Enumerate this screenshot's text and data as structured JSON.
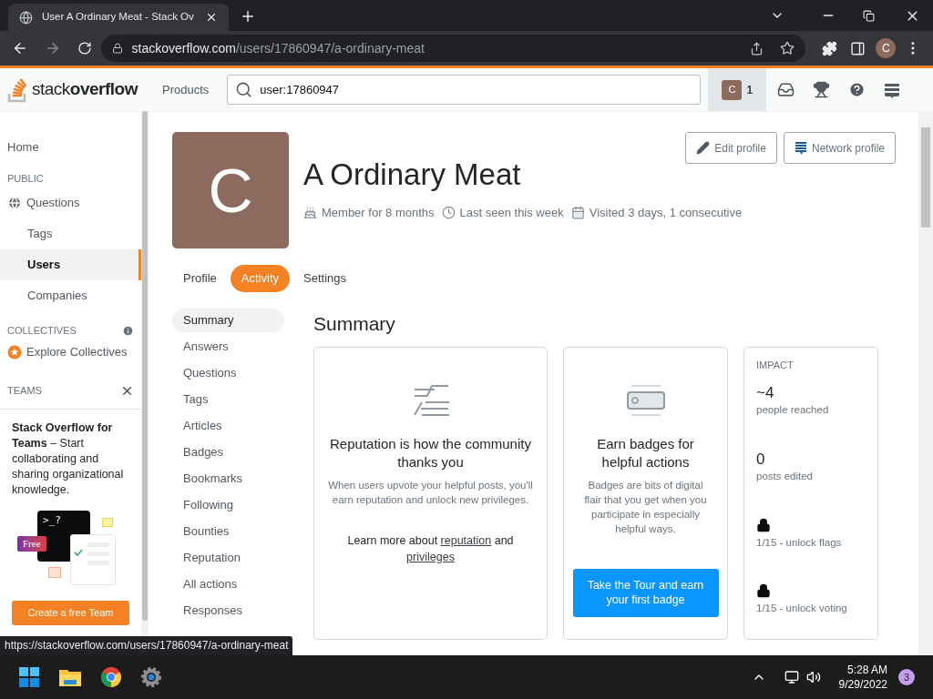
{
  "browser": {
    "tab_title": "User A Ordinary Meat - Stack Ov",
    "url_host": "stackoverflow.com",
    "url_path": "/users/17860947/a-ordinary-meat",
    "profile_letter": "C"
  },
  "header": {
    "logo": "stack**overflow**",
    "products": "Products",
    "search": "user:17860947",
    "avatar_letter": "C",
    "reputation": "1"
  },
  "sidebar": {
    "items": [
      {
        "kind": "link",
        "label": "Home",
        "selected": false
      },
      {
        "kind": "heading",
        "label": "PUBLIC"
      },
      {
        "kind": "globe",
        "label": "Questions",
        "selected": false
      },
      {
        "kind": "sub",
        "label": "Tags",
        "selected": false
      },
      {
        "kind": "sub",
        "label": "Users",
        "selected": true
      },
      {
        "kind": "sub",
        "label": "Companies",
        "selected": false
      },
      {
        "kind": "info-heading",
        "label": "COLLECTIVES"
      },
      {
        "kind": "collective",
        "label": "Explore Collectives",
        "selected": false
      },
      {
        "kind": "close-heading",
        "label": "TEAMS"
      }
    ],
    "teams": {
      "text": "**Stack Overflow for Teams** – Start collaborating and sharing organizational knowledge.",
      "prompt": ">_?",
      "free": "Free",
      "button": "Create a free Team"
    }
  },
  "profile": {
    "avatar_letter": "C",
    "name": "A Ordinary Meat",
    "meta": [
      {
        "kind": "cake",
        "text": "Member for 8 months"
      },
      {
        "kind": "clock",
        "text": "Last seen this week"
      },
      {
        "kind": "calendar",
        "text": "Visited 3 days, 1 consecutive"
      }
    ],
    "buttons": [
      {
        "kind": "edit",
        "label": "Edit profile"
      },
      {
        "kind": "network",
        "label": "Network profile"
      }
    ],
    "tabs": [
      {
        "label": "Profile",
        "selected": false
      },
      {
        "label": "Activity",
        "selected": true
      },
      {
        "label": "Settings",
        "selected": false
      }
    ],
    "nav": [
      {
        "label": "Summary",
        "selected": true
      },
      {
        "label": "Answers",
        "selected": false
      },
      {
        "label": "Questions",
        "selected": false
      },
      {
        "label": "Tags",
        "selected": false
      },
      {
        "label": "Articles",
        "selected": false
      },
      {
        "label": "Badges",
        "selected": false
      },
      {
        "label": "Bookmarks",
        "selected": false
      },
      {
        "label": "Following",
        "selected": false
      },
      {
        "label": "Bounties",
        "selected": false
      },
      {
        "label": "Reputation",
        "selected": false
      },
      {
        "label": "All actions",
        "selected": false
      },
      {
        "label": "Responses",
        "selected": false
      }
    ],
    "summary_title": "Summary",
    "reputation_card": {
      "title": "Reputation is how the community thanks you",
      "text": "When users upvote your helpful posts, you'll earn reputation and unlock new privileges.",
      "learn_more": [
        {
          "kind": "text",
          "text": "Learn more about "
        },
        {
          "kind": "link",
          "text": "reputation"
        },
        {
          "kind": "text",
          "text": " and "
        },
        {
          "kind": "link",
          "text": "privileges"
        }
      ]
    },
    "badges_card": {
      "title": "Earn badges for helpful actions",
      "text": "Badges are bits of digital flair that you get when you participate in especially helpful ways.",
      "button": "Take the Tour and earn your first badge"
    },
    "impact": {
      "title": "IMPACT",
      "stats": [
        {
          "kind": "number",
          "value": "~4",
          "label": "people reached"
        },
        {
          "kind": "number",
          "value": "0",
          "label": "posts edited"
        },
        {
          "kind": "locked",
          "label": "1/15 - unlock flags"
        },
        {
          "kind": "locked",
          "label": "1/15 - unlock voting"
        }
      ]
    }
  },
  "status_url": "https://stackoverflow.com/users/17860947/a-ordinary-meat",
  "taskbar": {
    "time": "5:28 AM",
    "date": "9/29/2022",
    "notifications": "3"
  }
}
